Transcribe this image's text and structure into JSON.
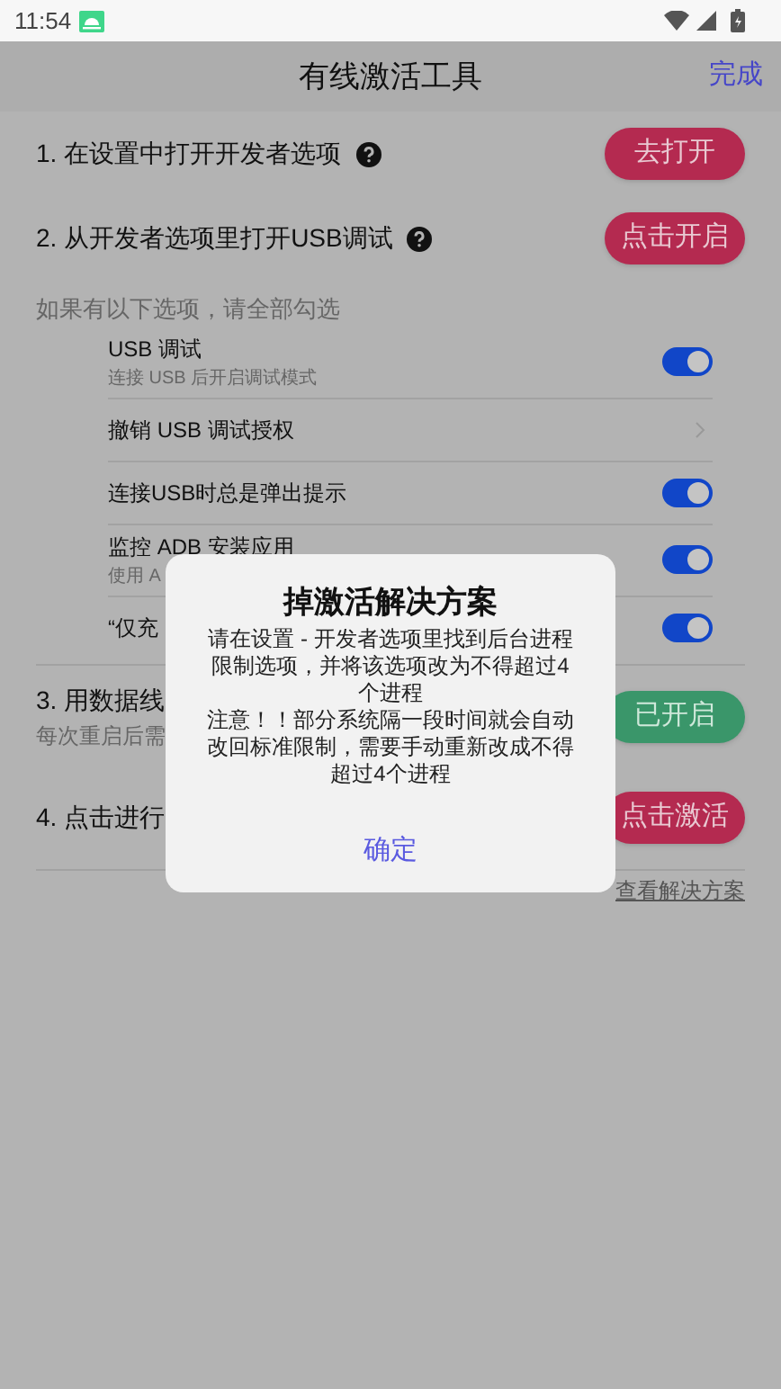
{
  "status_bar": {
    "time": "11:54"
  },
  "header": {
    "title": "有线激活工具",
    "action": "完成"
  },
  "steps": [
    {
      "label": "1. 在设置中打开开发者选项",
      "help": true,
      "button": {
        "label": "去打开",
        "kind": "action"
      }
    },
    {
      "label": "2. 从开发者选项里打开USB调试",
      "help": true,
      "button": {
        "label": "点击开启",
        "kind": "action"
      }
    }
  ],
  "hint": "如果有以下选项，请全部勾选",
  "options": [
    {
      "kind": "toggle",
      "title": "USB 调试",
      "subtitle": "连接 USB 后开启调试模式",
      "on": true
    },
    {
      "kind": "link",
      "title": "撤销 USB 调试授权"
    },
    {
      "kind": "toggle",
      "title": "连接USB时总是弹出提示",
      "on": true
    },
    {
      "kind": "toggle",
      "title": "监控 ADB 安装应用",
      "subtitle": "使用 A",
      "on": true
    },
    {
      "kind": "toggle",
      "title": "“仅充",
      "on": true
    }
  ],
  "later_steps": [
    {
      "label": "3. 用数据线",
      "subtitle": "每次重启后需",
      "button": {
        "label": "已开启",
        "kind": "done"
      }
    },
    {
      "label": "4. 点击进行",
      "button": {
        "label": "点击激活",
        "kind": "action"
      }
    }
  ],
  "footer_link": "查看解决方案",
  "dialog": {
    "title": "掉激活解决方案",
    "paragraphs": [
      "请在设置 - 开发者选项里找到后台进程限制选项，并将该选项改为不得超过4个进程",
      "注意！！部分系统隔一段时间就会自动改回标准限制，需要手动重新改成不得超过4个进程"
    ],
    "button": "确定"
  }
}
